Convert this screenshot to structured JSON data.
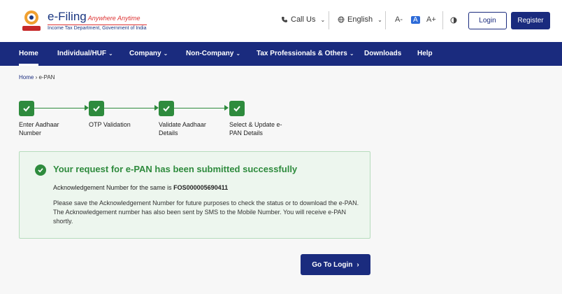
{
  "header": {
    "logo_title": "e-Filing",
    "logo_tagline": "Anywhere Anytime",
    "logo_subtitle": "Income Tax Department, Government of India",
    "call_us": "Call Us",
    "language": "English",
    "font_decrease": "A-",
    "font_normal": "A",
    "font_increase": "A+",
    "login": "Login",
    "register": "Register"
  },
  "nav": {
    "items": [
      {
        "label": "Home"
      },
      {
        "label": "Individual/HUF"
      },
      {
        "label": "Company"
      },
      {
        "label": "Non-Company"
      },
      {
        "label": "Tax Professionals & Others"
      },
      {
        "label": "Downloads"
      },
      {
        "label": "Help"
      }
    ]
  },
  "breadcrumb": {
    "home": "Home",
    "separator": "›",
    "current": "e-PAN"
  },
  "stepper": {
    "steps": [
      {
        "label": "Enter Aadhaar Number"
      },
      {
        "label": "OTP Validation"
      },
      {
        "label": "Validate Aadhaar Details"
      },
      {
        "label": "Select & Update e-PAN Details"
      }
    ]
  },
  "success": {
    "title": "Your request for e-PAN has been submitted successfully",
    "ack_prefix": "Acknowledgement Number for the same is",
    "ack_number": "FOS000005690411",
    "note": "Please save the Acknowledgement Number for future purposes to check the status or to download the e-PAN. The Acknowledgement number has also been sent by SMS to the Mobile Number. You will receive e-PAN shortly."
  },
  "actions": {
    "go_to_login": "Go To Login"
  },
  "colors": {
    "brand_navy": "#1a2b7e",
    "success_green": "#2e8b3d",
    "panel_bg": "#edf6ee"
  }
}
